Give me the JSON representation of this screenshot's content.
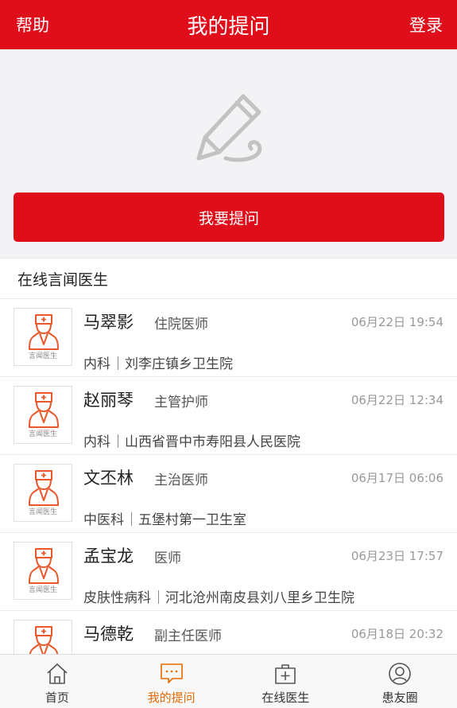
{
  "header": {
    "help": "帮助",
    "title": "我的提问",
    "login": "登录"
  },
  "hero": {
    "ask_button": "我要提问",
    "icon": "pencil-icon"
  },
  "section": {
    "title": "在线言闻医生"
  },
  "avatar_caption": "言闻医生",
  "doctors": [
    {
      "name": "马翠影",
      "role": "住院医师",
      "time": "06月22日 19:54",
      "dept": "内科",
      "hospital": "刘李庄镇乡卫生院"
    },
    {
      "name": "赵丽琴",
      "role": "主管护师",
      "time": "06月22日 12:34",
      "dept": "内科",
      "hospital": "山西省晋中市寿阳县人民医院"
    },
    {
      "name": "文丕林",
      "role": "主治医师",
      "time": "06月17日 06:06",
      "dept": "中医科",
      "hospital": "五堡村第一卫生室"
    },
    {
      "name": "孟宝龙",
      "role": "医师",
      "time": "06月23日 17:57",
      "dept": "皮肤性病科",
      "hospital": "河北沧州南皮县刘八里乡卫生院"
    },
    {
      "name": "马德乾",
      "role": "副主任医师",
      "time": "06月18日 20:32",
      "dept": "",
      "hospital": ""
    }
  ],
  "tabbar": {
    "active_color": "#e66a00",
    "items": [
      {
        "label": "首页",
        "icon": "home-icon"
      },
      {
        "label": "我的提问",
        "icon": "chat-icon"
      },
      {
        "label": "在线医生",
        "icon": "medical-kit-icon"
      },
      {
        "label": "患友圈",
        "icon": "user-circle-icon"
      }
    ]
  }
}
